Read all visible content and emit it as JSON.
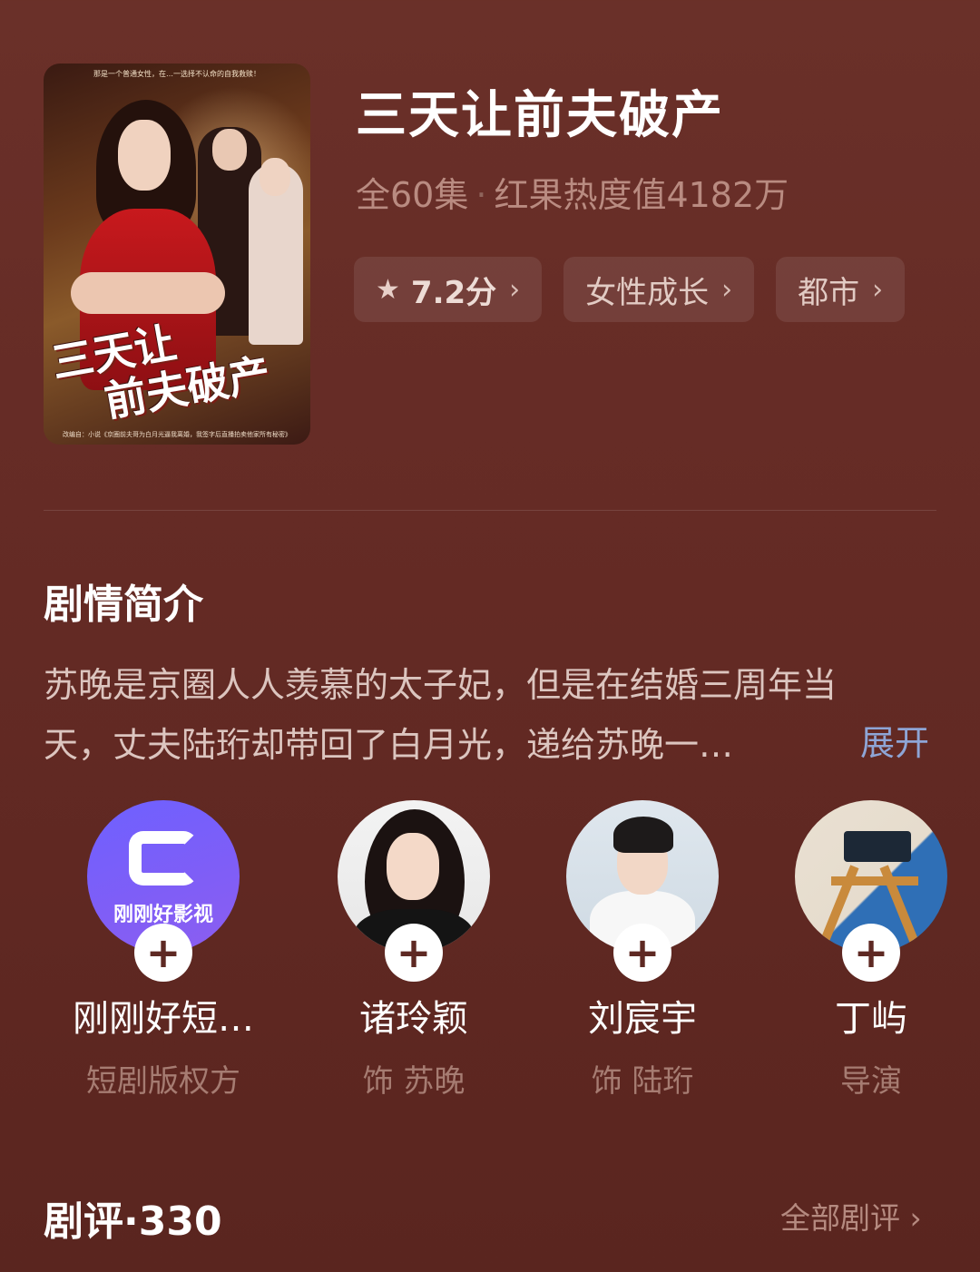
{
  "poster": {
    "top_tagline": "那是一个普通女性，在…一选择不认命的自我救赎！",
    "title_line1": "三天让",
    "title_line2": "前夫破产",
    "footnote": "改编自：小说《京圈前夫哥为白月光逼我离婚，我签字后直播拍卖他家所有秘密》"
  },
  "drama": {
    "title": "三天让前夫破产",
    "episodes": "全60集",
    "separator": "·",
    "heat": "红果热度值4182万"
  },
  "tags": [
    {
      "icon": "star-icon",
      "label": "7.2分",
      "chevron": "›"
    },
    {
      "label": "女性成长",
      "chevron": "›"
    },
    {
      "label": "都市",
      "chevron": "›"
    }
  ],
  "synopsis": {
    "heading": "剧情简介",
    "line1": "苏晚是京圈人人羡慕的太子妃，但是在结婚三周年当",
    "line2": "天，丈夫陆珩却带回了白月光，递给苏晚一…",
    "expand": "展开"
  },
  "people": [
    {
      "name": "刚刚好短…",
      "role": "短剧版权方",
      "avatar_text": "刚刚好影视",
      "follow": "+"
    },
    {
      "name": "诸玲颖",
      "role": "饰 苏晚",
      "follow": "+"
    },
    {
      "name": "刘宸宇",
      "role": "饰 陆珩",
      "follow": "+"
    },
    {
      "name": "丁屿",
      "role": "导演",
      "follow": "+"
    }
  ],
  "reviews": {
    "title": "剧评·330",
    "all_link": "全部剧评 ›"
  },
  "colors": {
    "background": "#652b25",
    "accent_link": "#8ea5d6",
    "muted_text": "#b98b81"
  }
}
